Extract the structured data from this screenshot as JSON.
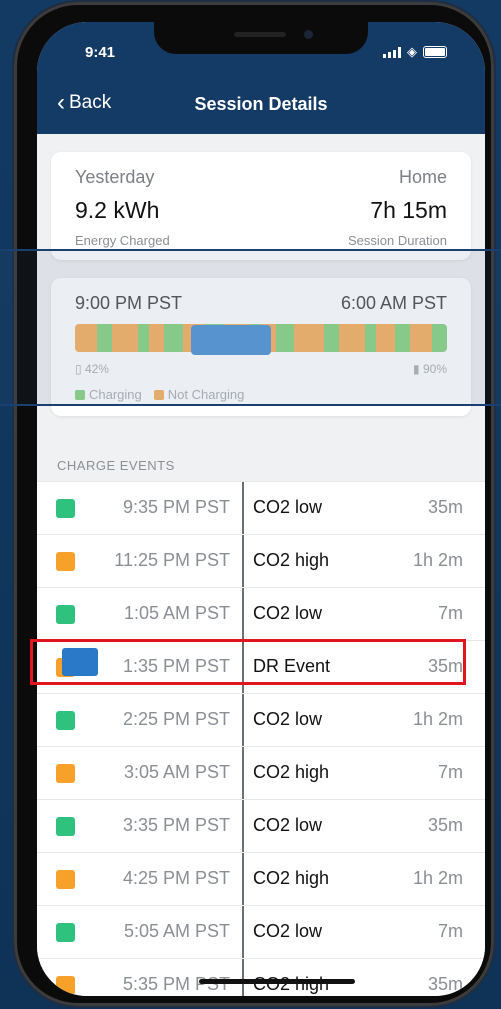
{
  "status": {
    "time": "9:41"
  },
  "nav": {
    "back_label": "Back",
    "title": "Session Details"
  },
  "summary": {
    "day": "Yesterday",
    "location": "Home",
    "energy": "9.2 kWh",
    "duration": "7h 15m",
    "energy_label": "Energy Charged",
    "duration_label": "Session Duration"
  },
  "timeline": {
    "start": "9:00 PM PST",
    "end": "6:00 AM PST",
    "battery_start": "42%",
    "battery_end": "90%",
    "legend_charging": "Charging",
    "legend_not_charging": "Not Charging",
    "colors": {
      "charging": "#8fd68a",
      "not_charging": "#f6b66a",
      "dr_event": "#5b9bd8"
    },
    "segments": [
      {
        "state": "not_charging",
        "fraction": 0.06
      },
      {
        "state": "charging",
        "fraction": 0.04
      },
      {
        "state": "not_charging",
        "fraction": 0.07
      },
      {
        "state": "charging",
        "fraction": 0.03
      },
      {
        "state": "not_charging",
        "fraction": 0.04
      },
      {
        "state": "charging",
        "fraction": 0.05
      },
      {
        "state": "not_charging",
        "fraction": 0.06
      },
      {
        "state": "charging",
        "fraction": 0.05
      },
      {
        "state": "not_charging",
        "fraction": 0.07
      },
      {
        "state": "charging",
        "fraction": 0.03
      },
      {
        "state": "not_charging",
        "fraction": 0.04
      },
      {
        "state": "charging",
        "fraction": 0.05
      },
      {
        "state": "not_charging",
        "fraction": 0.08
      },
      {
        "state": "charging",
        "fraction": 0.04
      },
      {
        "state": "not_charging",
        "fraction": 0.07
      },
      {
        "state": "charging",
        "fraction": 0.03
      },
      {
        "state": "not_charging",
        "fraction": 0.05
      },
      {
        "state": "charging",
        "fraction": 0.04
      },
      {
        "state": "not_charging",
        "fraction": 0.06
      },
      {
        "state": "charging",
        "fraction": 0.04
      }
    ]
  },
  "events": {
    "section_label": "CHARGE EVENTS",
    "items": [
      {
        "time": "9:35 PM PST",
        "type": "CO2 low",
        "duration": "35m",
        "color": "#2ec27e"
      },
      {
        "time": "11:25 PM PST",
        "type": "CO2 high",
        "duration": "1h 2m",
        "color": "#f7a02a"
      },
      {
        "time": "1:05 AM PST",
        "type": "CO2 low",
        "duration": "7m",
        "color": "#2ec27e"
      },
      {
        "time": "1:35 PM PST",
        "type": "DR Event",
        "duration": "35m",
        "color": "#f7a02a"
      },
      {
        "time": "2:25 PM PST",
        "type": "CO2 low",
        "duration": "1h 2m",
        "color": "#2ec27e"
      },
      {
        "time": "3:05 AM PST",
        "type": "CO2 high",
        "duration": "7m",
        "color": "#f7a02a"
      },
      {
        "time": "3:35 PM PST",
        "type": "CO2 low",
        "duration": "35m",
        "color": "#2ec27e"
      },
      {
        "time": "4:25 PM PST",
        "type": "CO2 high",
        "duration": "1h 2m",
        "color": "#f7a02a"
      },
      {
        "time": "5:05 AM PST",
        "type": "CO2 low",
        "duration": "7m",
        "color": "#2ec27e"
      },
      {
        "time": "5:35 PM PST",
        "type": "CO2 high",
        "duration": "35m",
        "color": "#f7a02a"
      }
    ]
  }
}
